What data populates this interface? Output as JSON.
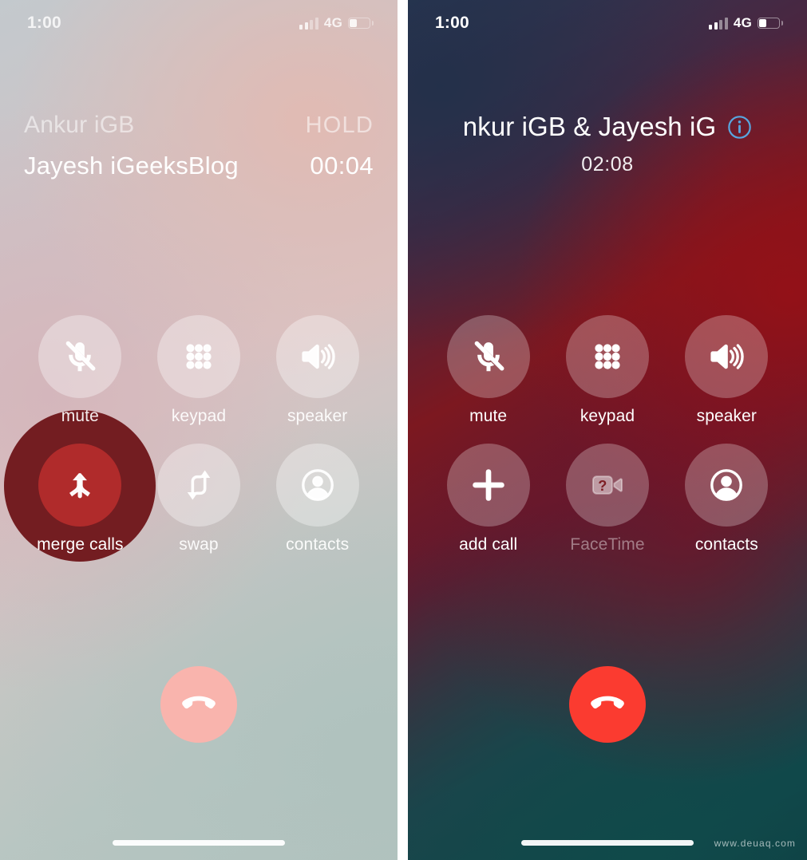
{
  "meta": {
    "watermark": "www.deuaq.com"
  },
  "left_panel": {
    "status_bar": {
      "time": "1:00",
      "network": "4G",
      "signal_icon": "signal-bars-icon",
      "battery_icon": "battery-icon",
      "signal_bars_filled": 2,
      "signal_bars_total": 4,
      "battery_percent": 35
    },
    "header": {
      "held_call_name": "Ankur iGB",
      "held_call_state": "HOLD",
      "active_call_name": "Jayesh iGeeksBlog",
      "active_call_timer": "00:04"
    },
    "buttons": [
      {
        "label": "mute",
        "icon": "microphone-slash-icon",
        "state": "normal"
      },
      {
        "label": "keypad",
        "icon": "keypad-dots-icon",
        "state": "normal"
      },
      {
        "label": "speaker",
        "icon": "speaker-waves-icon",
        "state": "normal"
      },
      {
        "label": "merge calls",
        "icon": "merge-arrow-icon",
        "state": "tapped"
      },
      {
        "label": "swap",
        "icon": "swap-arrows-icon",
        "state": "normal"
      },
      {
        "label": "contacts",
        "icon": "contact-person-icon",
        "state": "normal"
      }
    ],
    "end_call": {
      "label": "end call",
      "icon": "phone-hangup-icon",
      "color": "#f9b4ad"
    },
    "home_indicator": "home-indicator-bar"
  },
  "right_panel": {
    "status_bar": {
      "time": "1:00",
      "network": "4G",
      "signal_icon": "signal-bars-icon",
      "battery_icon": "battery-icon",
      "signal_bars_filled": 2,
      "signal_bars_total": 4,
      "battery_percent": 35
    },
    "header": {
      "merged_title": "nkur iGB & Jayesh iG",
      "info_icon": "info-circle-icon",
      "info_icon_color": "#58a6df",
      "timer": "02:08"
    },
    "buttons": [
      {
        "label": "mute",
        "icon": "microphone-slash-icon",
        "state": "normal"
      },
      {
        "label": "keypad",
        "icon": "keypad-dots-icon",
        "state": "normal"
      },
      {
        "label": "speaker",
        "icon": "speaker-waves-icon",
        "state": "normal"
      },
      {
        "label": "add call",
        "icon": "plus-icon",
        "state": "normal"
      },
      {
        "label": "FaceTime",
        "icon": "video-camera-question-icon",
        "state": "disabled"
      },
      {
        "label": "contacts",
        "icon": "contact-person-icon",
        "state": "normal"
      }
    ],
    "end_call": {
      "label": "end call",
      "icon": "phone-hangup-icon",
      "color": "#fb3b30"
    },
    "home_indicator": "home-indicator-bar"
  }
}
